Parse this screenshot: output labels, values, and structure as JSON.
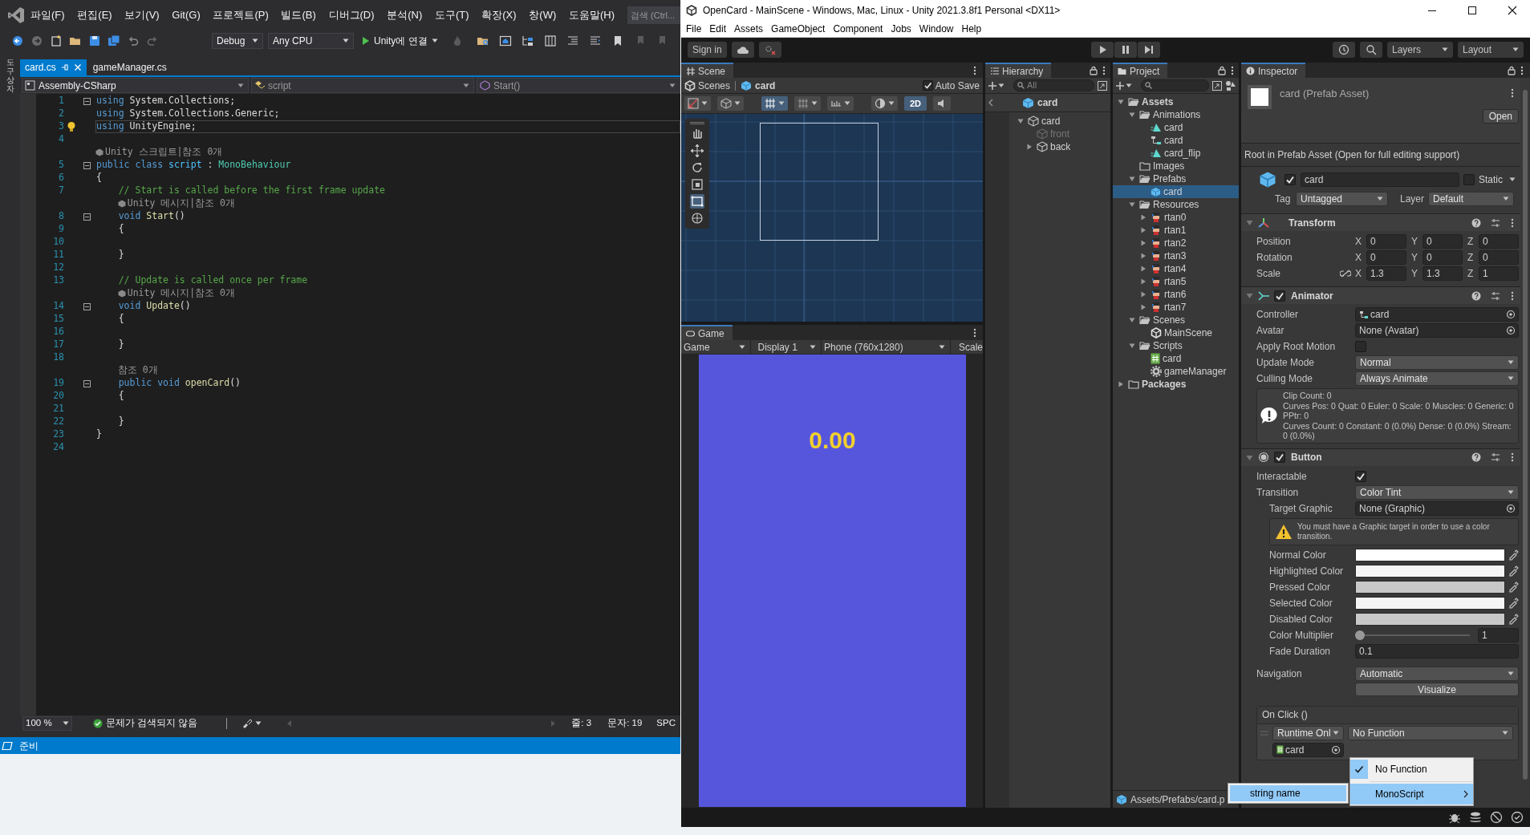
{
  "vs": {
    "menu": [
      "파일(F)",
      "편집(E)",
      "보기(V)",
      "Git(G)",
      "프로젝트(P)",
      "빌드(B)",
      "디버그(D)",
      "분석(N)",
      "도구(T)",
      "확장(X)",
      "창(W)",
      "도움말(H)"
    ],
    "search": "검색 (Ctrl...",
    "toolbar": {
      "configuration": "Debug",
      "platform": "Any CPU",
      "run": "Unity에 연결"
    },
    "side_tab": "도구 상자",
    "tabs": [
      {
        "label": "card.cs",
        "selected": true
      },
      {
        "label": "gameManager.cs",
        "selected": false
      }
    ],
    "nav": [
      "Assembly-CSharp",
      "script",
      "Start()"
    ],
    "lines": [
      {
        "kind": "code",
        "n": "1",
        "fold": true,
        "current": false,
        "bulb": false,
        "tokens": [
          {
            "kind": "kw",
            "text": "using"
          },
          {
            "kind": "txt",
            "text": " System.Collections;"
          }
        ]
      },
      {
        "kind": "code",
        "n": "2",
        "fold": false,
        "current": false,
        "bulb": false,
        "tokens": [
          {
            "kind": "kw",
            "text": "using"
          },
          {
            "kind": "txt",
            "text": " System.Collections.Generic;"
          }
        ]
      },
      {
        "kind": "code",
        "n": "3",
        "fold": false,
        "current": true,
        "bulb": true,
        "tokens": [
          {
            "kind": "kw",
            "text": "using"
          },
          {
            "kind": "txt",
            "text": " UnityEngine;"
          }
        ]
      },
      {
        "kind": "code",
        "n": "4",
        "fold": false,
        "current": false,
        "bulb": false
      },
      {
        "kind": "lens",
        "unity": true,
        "text": "Unity 스크립트|참조 0개"
      },
      {
        "kind": "code",
        "n": "5",
        "fold": true,
        "current": false,
        "bulb": false,
        "tokens": [
          {
            "kind": "kw",
            "text": "public class"
          },
          {
            "kind": "name",
            "text": " script"
          },
          {
            "kind": "txt",
            "text": " : "
          },
          {
            "kind": "type",
            "text": "MonoBehaviour"
          }
        ]
      },
      {
        "kind": "code",
        "n": "6",
        "fold": false,
        "current": false,
        "bulb": false,
        "tokens": [
          {
            "kind": "txt",
            "text": "{"
          }
        ]
      },
      {
        "kind": "code",
        "n": "7",
        "fold": false,
        "current": false,
        "bulb": false,
        "tokens": [
          {
            "kind": "cmt",
            "text": "    // Start is called before the first frame update"
          }
        ]
      },
      {
        "kind": "lens",
        "unity": true,
        "text": "Unity 메시지|참조 0개"
      },
      {
        "kind": "code",
        "n": "8",
        "fold": true,
        "current": false,
        "bulb": false,
        "tokens": [
          {
            "kind": "kw",
            "text": "    void"
          },
          {
            "kind": "fn",
            "text": " Start"
          },
          {
            "kind": "txt",
            "text": "()"
          }
        ]
      },
      {
        "kind": "code",
        "n": "9",
        "fold": false,
        "current": false,
        "bulb": false,
        "tokens": [
          {
            "kind": "txt",
            "text": "    {"
          }
        ]
      },
      {
        "kind": "code",
        "n": "10",
        "fold": false,
        "current": false,
        "bulb": false
      },
      {
        "kind": "code",
        "n": "11",
        "fold": false,
        "current": false,
        "bulb": false,
        "tokens": [
          {
            "kind": "txt",
            "text": "    }"
          }
        ]
      },
      {
        "kind": "code",
        "n": "12",
        "fold": false,
        "current": false,
        "bulb": false
      },
      {
        "kind": "code",
        "n": "13",
        "fold": false,
        "current": false,
        "bulb": false,
        "tokens": [
          {
            "kind": "cmt",
            "text": "    // Update is called once per frame"
          }
        ]
      },
      {
        "kind": "lens",
        "unity": true,
        "text": "Unity 메시지|참조 0개"
      },
      {
        "kind": "code",
        "n": "14",
        "fold": true,
        "current": false,
        "bulb": false,
        "tokens": [
          {
            "kind": "kw",
            "text": "    void"
          },
          {
            "kind": "fn",
            "text": " Update"
          },
          {
            "kind": "txt",
            "text": "()"
          }
        ]
      },
      {
        "kind": "code",
        "n": "15",
        "fold": false,
        "current": false,
        "bulb": false,
        "tokens": [
          {
            "kind": "txt",
            "text": "    {"
          }
        ]
      },
      {
        "kind": "code",
        "n": "16",
        "fold": false,
        "current": false,
        "bulb": false
      },
      {
        "kind": "code",
        "n": "17",
        "fold": false,
        "current": false,
        "bulb": false,
        "tokens": [
          {
            "kind": "txt",
            "text": "    }"
          }
        ]
      },
      {
        "kind": "code",
        "n": "18",
        "fold": false,
        "current": false,
        "bulb": false
      },
      {
        "kind": "lens",
        "unity": false,
        "text": "참조 0개"
      },
      {
        "kind": "code",
        "n": "19",
        "fold": true,
        "current": false,
        "bulb": false,
        "tokens": [
          {
            "kind": "kw",
            "text": "    public void"
          },
          {
            "kind": "fn",
            "text": " openCard"
          },
          {
            "kind": "txt",
            "text": "()"
          }
        ]
      },
      {
        "kind": "code",
        "n": "20",
        "fold": false,
        "current": false,
        "bulb": false,
        "tokens": [
          {
            "kind": "txt",
            "text": "    {"
          }
        ]
      },
      {
        "kind": "code",
        "n": "21",
        "fold": false,
        "current": false,
        "bulb": false
      },
      {
        "kind": "code",
        "n": "22",
        "fold": false,
        "current": false,
        "bulb": false,
        "tokens": [
          {
            "kind": "txt",
            "text": "    }"
          }
        ]
      },
      {
        "kind": "code",
        "n": "23",
        "fold": false,
        "current": false,
        "bulb": false,
        "tokens": [
          {
            "kind": "txt",
            "text": "}"
          }
        ]
      },
      {
        "kind": "code",
        "n": "24",
        "fold": false,
        "current": false,
        "bulb": false
      }
    ],
    "status": {
      "zoom": "100 %",
      "issues": "문제가 검색되지 않음",
      "line": "줄: 3",
      "column": "문자: 19",
      "spacing": "SPC"
    },
    "ready": "준비"
  },
  "unity": {
    "title": "OpenCard - MainScene - Windows, Mac, Linux - Unity 2021.3.8f1 Personal <DX11>",
    "menu": [
      "File",
      "Edit",
      "Assets",
      "GameObject",
      "Component",
      "Jobs",
      "Window",
      "Help"
    ],
    "toolbar": {
      "sign_in": "Sign in",
      "layers": "Layers",
      "layout": "Layout"
    },
    "scene": {
      "tab": "Scene",
      "breadcrumb": [
        "Scenes",
        "card"
      ],
      "auto_save": {
        "label": "Auto Save",
        "checked": true
      },
      "mode_2d": {
        "label": "2D",
        "selected": true
      }
    },
    "game": {
      "tab": "Game",
      "display_mode": "Game",
      "display": "Display 1",
      "resolution": "Phone (760x1280)",
      "scale": "Scale",
      "score": "0.00"
    },
    "hierarchy": {
      "tab": "Hierarchy",
      "search": "All",
      "context": "card",
      "tree": [
        {
          "label": "card",
          "active": true,
          "expanded": true,
          "children": [
            {
              "label": "front",
              "active": false
            },
            {
              "label": "back",
              "active": true,
              "expanded": false
            }
          ]
        }
      ]
    },
    "project": {
      "tab": "Project",
      "tree": [
        {
          "label": "Assets",
          "kind": "folder",
          "expanded": true,
          "selected": false,
          "children": [
            {
              "label": "Animations",
              "kind": "folder",
              "expanded": true,
              "selected": false,
              "children": [
                {
                  "label": "card",
                  "kind": "anim",
                  "selected": false
                },
                {
                  "label": "card",
                  "kind": "controller",
                  "selected": false
                },
                {
                  "label": "card_flip",
                  "kind": "anim",
                  "selected": false
                }
              ]
            },
            {
              "label": "Images",
              "kind": "folder",
              "selected": false
            },
            {
              "label": "Prefabs",
              "kind": "folder",
              "expanded": true,
              "selected": false,
              "children": [
                {
                  "label": "card",
                  "kind": "prefab",
                  "selected": true
                }
              ]
            },
            {
              "label": "Resources",
              "kind": "folder",
              "expanded": true,
              "selected": false,
              "children": [
                {
                  "label": "rtan0",
                  "kind": "sprite",
                  "expanded": false,
                  "selected": false
                },
                {
                  "label": "rtan1",
                  "kind": "sprite",
                  "expanded": false,
                  "selected": false
                },
                {
                  "label": "rtan2",
                  "kind": "sprite",
                  "expanded": false,
                  "selected": false
                },
                {
                  "label": "rtan3",
                  "kind": "sprite",
                  "expanded": false,
                  "selected": false
                },
                {
                  "label": "rtan4",
                  "kind": "sprite",
                  "expanded": false,
                  "selected": false
                },
                {
                  "label": "rtan5",
                  "kind": "sprite",
                  "expanded": false,
                  "selected": false
                },
                {
                  "label": "rtan6",
                  "kind": "sprite",
                  "expanded": false,
                  "selected": false
                },
                {
                  "label": "rtan7",
                  "kind": "sprite",
                  "expanded": false,
                  "selected": false
                }
              ]
            },
            {
              "label": "Scenes",
              "kind": "folder",
              "expanded": true,
              "selected": false,
              "children": [
                {
                  "label": "MainScene",
                  "kind": "scene",
                  "selected": false
                }
              ]
            },
            {
              "label": "Scripts",
              "kind": "folder",
              "expanded": true,
              "selected": false,
              "children": [
                {
                  "label": "card",
                  "kind": "script",
                  "selected": false
                },
                {
                  "label": "gameManager",
                  "kind": "gear",
                  "selected": false
                }
              ]
            }
          ]
        },
        {
          "label": "Packages",
          "kind": "folder",
          "expanded": false,
          "selected": false
        }
      ],
      "footer": "Assets/Prefabs/card.p"
    },
    "inspector": {
      "tab": "Inspector",
      "title": "card (Prefab Asset)",
      "open": "Open",
      "notice": "Root in Prefab Asset (Open for full editing support)",
      "object": {
        "active": true,
        "name": "card",
        "static": {
          "label": "Static",
          "checked": false
        },
        "tag_label": "Tag",
        "tag": "Untagged",
        "layer_label": "Layer",
        "layer": "Default"
      },
      "components": [
        {
          "kind": "transform",
          "title": "Transform",
          "expanded": true,
          "rows": [
            {
              "kind": "vector",
              "label": "Position",
              "values": [
                {
                  "axis": "X",
                  "value": "0"
                },
                {
                  "axis": "Y",
                  "value": "0"
                },
                {
                  "axis": "Z",
                  "value": "0"
                }
              ]
            },
            {
              "kind": "vector",
              "label": "Rotation",
              "values": [
                {
                  "axis": "X",
                  "value": "0"
                },
                {
                  "axis": "Y",
                  "value": "0"
                },
                {
                  "axis": "Z",
                  "value": "0"
                }
              ]
            },
            {
              "kind": "scale",
              "label": "Scale",
              "values": [
                {
                  "axis": "X",
                  "value": "1.3"
                },
                {
                  "axis": "Y",
                  "value": "1.3"
                },
                {
                  "axis": "Z",
                  "value": "1"
                }
              ]
            }
          ]
        },
        {
          "kind": "animator",
          "title": "Animator",
          "expanded": true,
          "enabled": true,
          "fields": [
            {
              "kind": "object",
              "label": "Controller",
              "value": "card"
            },
            {
              "kind": "object",
              "label": "Avatar",
              "value": "None (Avatar)"
            },
            {
              "kind": "checkbox",
              "label": "Apply Root Motion",
              "checked": false
            },
            {
              "kind": "dropdown",
              "label": "Update Mode",
              "value": "Normal"
            },
            {
              "kind": "dropdown",
              "label": "Culling Mode",
              "value": "Always Animate"
            }
          ],
          "info": [
            "Clip Count: 0",
            "Curves Pos: 0 Quat: 0 Euler: 0 Scale: 0 Muscles: 0 Generic: 0 PPtr: 0",
            "Curves Count: 0 Constant: 0 (0.0%) Dense: 0 (0.0%) Stream: 0 (0.0%)"
          ]
        },
        {
          "kind": "button",
          "title": "Button",
          "expanded": true,
          "enabled": true,
          "fields": [
            {
              "kind": "checkbox",
              "label": "Interactable",
              "checked": true
            },
            {
              "kind": "dropdown",
              "label": "Transition",
              "value": "Color Tint",
              "children": [
                {
                  "kind": "object",
                  "label": "Target Graphic",
                  "value": "None (Graphic)"
                },
                {
                  "kind": "warning",
                  "text": "You must have a Graphic target in order to use a color transition."
                },
                {
                  "kind": "color",
                  "label": "Normal Color",
                  "color": "#ffffff"
                },
                {
                  "kind": "color",
                  "label": "Highlighted Color",
                  "color": "#f5f5f5"
                },
                {
                  "kind": "color",
                  "label": "Pressed Color",
                  "color": "#c8c8c8"
                },
                {
                  "kind": "color",
                  "label": "Selected Color",
                  "color": "#f5f5f5"
                },
                {
                  "kind": "color",
                  "label": "Disabled Color",
                  "color": "#c8c8c8"
                },
                {
                  "kind": "slider",
                  "label": "Color Multiplier",
                  "level": 0,
                  "reading": "1"
                },
                {
                  "kind": "text",
                  "label": "Fade Duration",
                  "value": "0.1"
                }
              ]
            },
            {
              "kind": "dropdown",
              "label": "Navigation",
              "value": "Automatic"
            },
            {
              "kind": "action",
              "label": "Visualize"
            }
          ],
          "on_click": {
            "title": "On Click ()",
            "runtime": "Runtime Onl",
            "function": "No Function",
            "target": "card"
          }
        }
      ]
    },
    "popup": {
      "items": [
        {
          "label": "No Function",
          "checked": true,
          "selected": false
        },
        {
          "label": "MonoScript",
          "checked": false,
          "selected": true,
          "children": [
            {
              "label": "string name",
              "selected": true
            }
          ]
        }
      ]
    }
  }
}
